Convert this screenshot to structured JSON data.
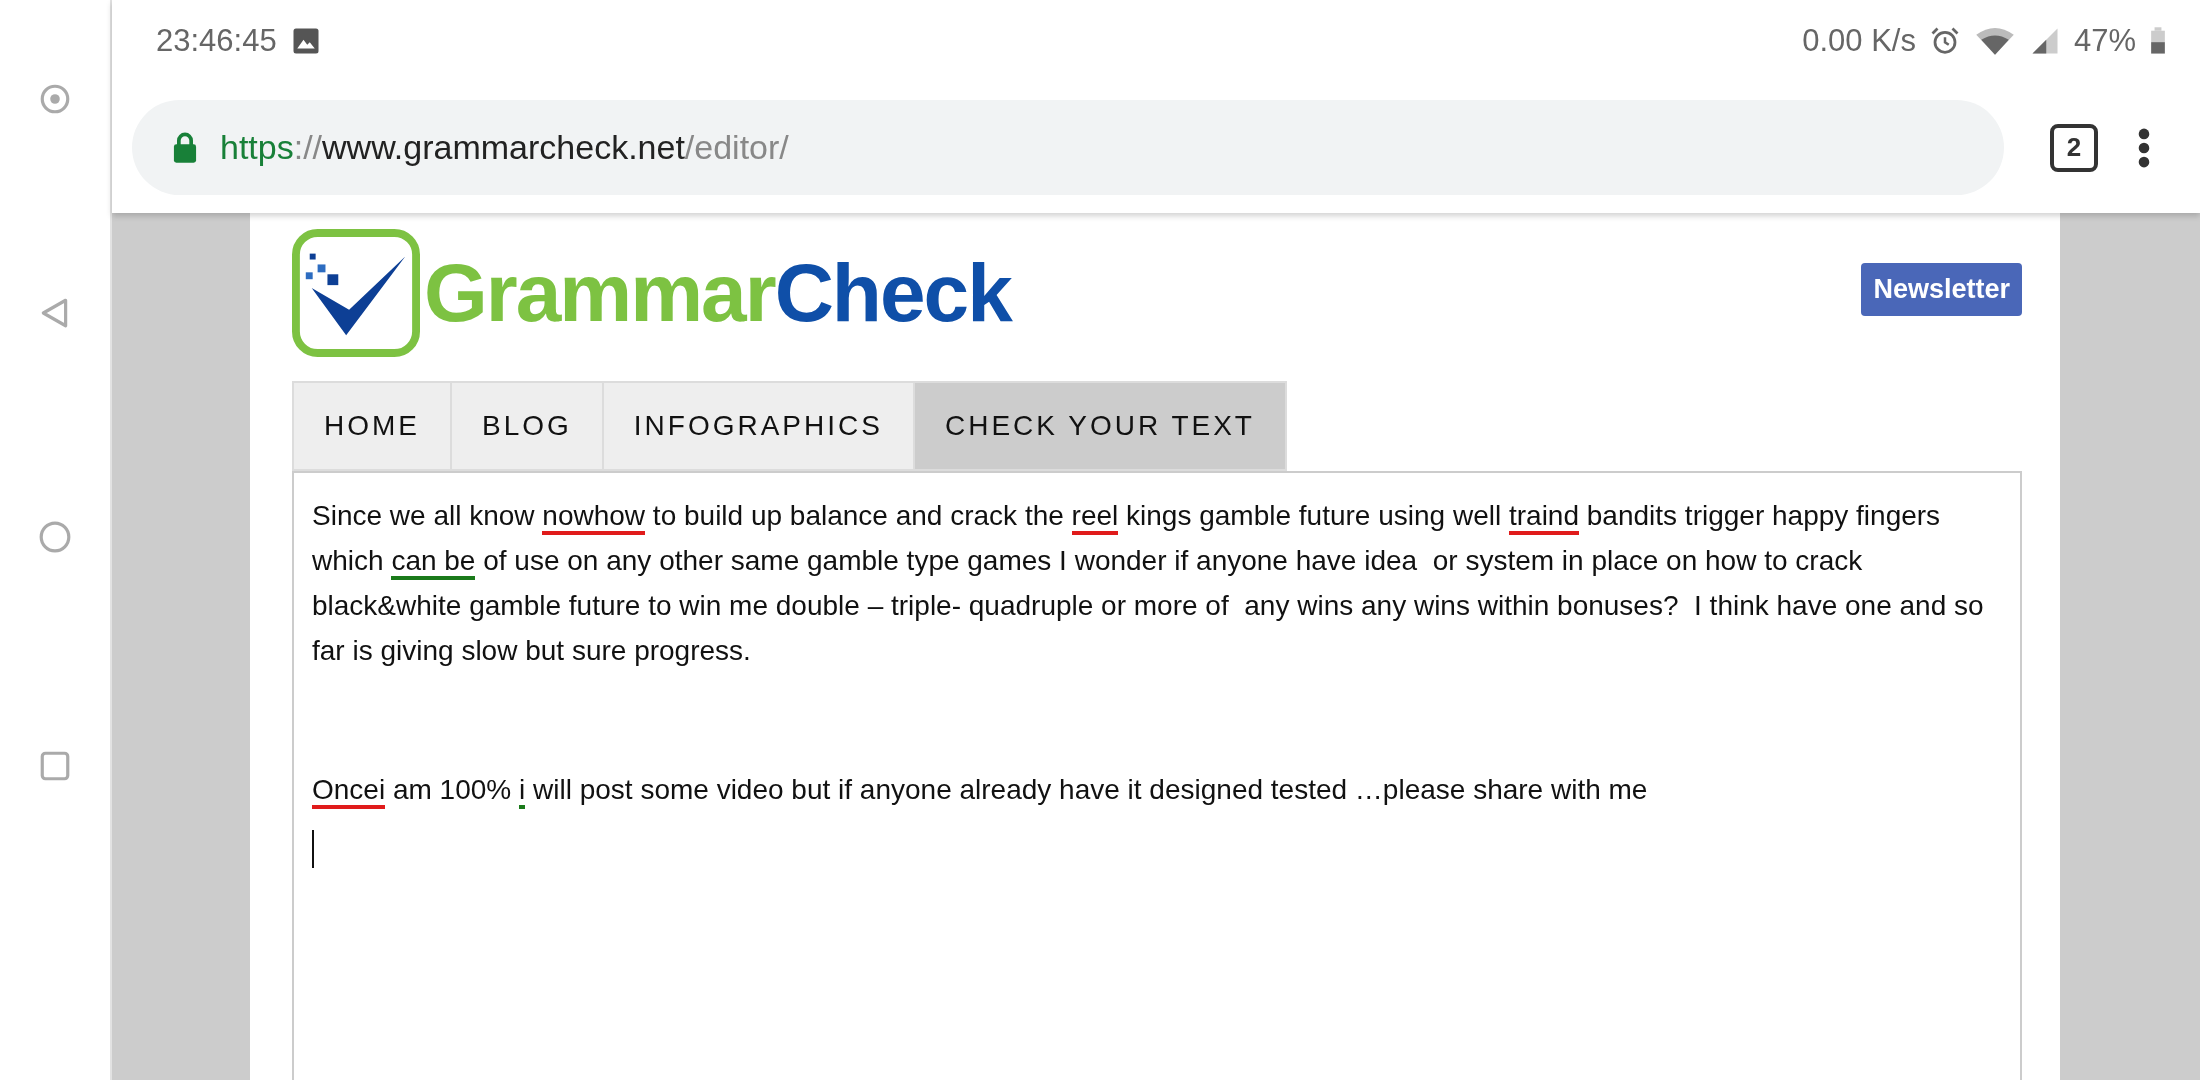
{
  "status_bar": {
    "time": "23:46:45",
    "speed": "0.00 K/s",
    "battery": "47%"
  },
  "address_bar": {
    "scheme": "https",
    "separator": "://",
    "host": "www.grammarcheck.net",
    "path": "/editor/",
    "tab_count": "2"
  },
  "logo": {
    "parts": [
      {
        "text": "Grammar",
        "color": "#7dc242"
      },
      {
        "text": "Check",
        "color": "#0f4fa8"
      }
    ]
  },
  "newsletter_button": "Newsletter",
  "tabs": [
    {
      "label": "HOME",
      "selected": false
    },
    {
      "label": "BLOG",
      "selected": false
    },
    {
      "label": "INFOGRAPHICS",
      "selected": false
    },
    {
      "label": "CHECK YOUR TEXT",
      "selected": true
    }
  ],
  "editor": {
    "paragraphs": [
      {
        "segments": [
          {
            "text": "Since we all know "
          },
          {
            "text": "nowhow",
            "color": "#e01b1b"
          },
          {
            "text": " to build up balance and crack the "
          },
          {
            "text": "reel",
            "color": "#e01b1b"
          },
          {
            "text": " kings gamble future using well "
          },
          {
            "text": "traind",
            "color": "#e01b1b"
          },
          {
            "text": " bandits trigger happy fingers   which "
          },
          {
            "text": "can be",
            "color": "#1a7a1a"
          },
          {
            "text": " of use on any other same gamble type games I wonder if anyone have idea  or system in place on how to crack black&white gamble future to win me double – triple- quadruple or more of  any wins any wins within bonuses?  I think have one and so far is giving slow but sure progress."
          }
        ]
      },
      {
        "segments": [
          {
            "text": "Oncei",
            "color": "#e01b1b"
          },
          {
            "text": " am 100% "
          },
          {
            "text": "i",
            "color": "#1a7a1a"
          },
          {
            "text": " will post some video but if anyone already have it designed tested …please share with me"
          }
        ]
      }
    ]
  }
}
